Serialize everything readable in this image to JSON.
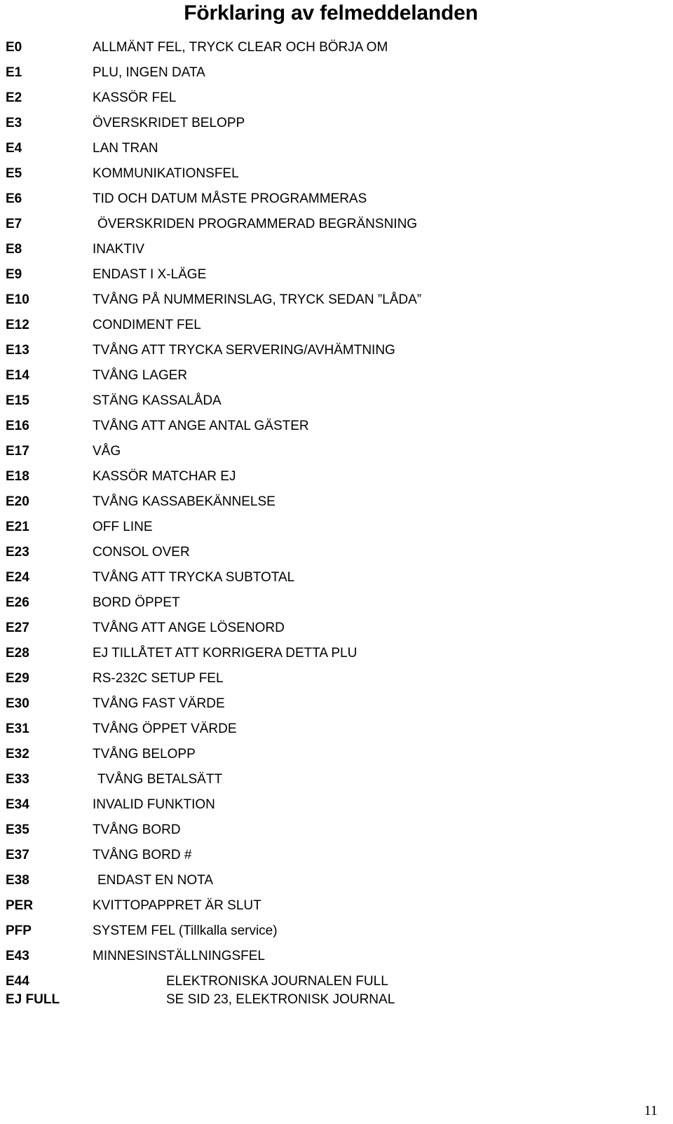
{
  "document": {
    "title": "Förklaring av felmeddelanden",
    "page_number": "11"
  },
  "error_table": {
    "rows": [
      {
        "code": "E0",
        "desc": "ALLMÄNT FEL, TRYCK CLEAR OCH BÖRJA OM"
      },
      {
        "code": "E1",
        "desc": "PLU, INGEN DATA"
      },
      {
        "code": "E2",
        "desc": "KASSÖR FEL"
      },
      {
        "code": "E3",
        "desc": "ÖVERSKRIDET BELOPP"
      },
      {
        "code": "E4",
        "desc": "LAN TRAN"
      },
      {
        "code": "E5",
        "desc": "KOMMUNIKATIONSFEL"
      },
      {
        "code": "E6",
        "desc": "TID OCH DATUM MÅSTE PROGRAMMERAS"
      },
      {
        "code": "E7",
        "desc": "ÖVERSKRIDEN PROGRAMMERAD BEGRÄNSNING"
      },
      {
        "code": "E8",
        "desc": "INAKTIV"
      },
      {
        "code": "E9",
        "desc": "ENDAST I X-LÄGE"
      },
      {
        "code": "E10",
        "desc": "TVÅNG PÅ NUMMERINSLAG, TRYCK SEDAN ”LÅDA”"
      },
      {
        "code": "E12",
        "desc": "CONDIMENT FEL"
      },
      {
        "code": "E13",
        "desc": "TVÅNG ATT TRYCKA SERVERING/AVHÄMTNING"
      },
      {
        "code": "E14",
        "desc": "TVÅNG LAGER"
      },
      {
        "code": "E15",
        "desc": "STÄNG KASSALÅDA"
      },
      {
        "code": "E16",
        "desc": "TVÅNG ATT ANGE ANTAL GÄSTER"
      },
      {
        "code": "E17",
        "desc": "VÅG"
      },
      {
        "code": "E18",
        "desc": "KASSÖR MATCHAR EJ"
      },
      {
        "code": "E20",
        "desc": "TVÅNG KASSABEKÄNNELSE"
      },
      {
        "code": "E21",
        "desc": "OFF LINE"
      },
      {
        "code": "E23",
        "desc": "CONSOL OVER"
      },
      {
        "code": "E24",
        "desc": "TVÅNG ATT TRYCKA SUBTOTAL"
      },
      {
        "code": "E26",
        "desc": "BORD ÖPPET"
      },
      {
        "code": "E27",
        "desc": "TVÅNG ATT ANGE LÖSENORD"
      },
      {
        "code": "E28",
        "desc": "EJ TILLÅTET ATT KORRIGERA DETTA PLU"
      },
      {
        "code": "E29",
        "desc": "RS-232C SETUP FEL"
      },
      {
        "code": "E30",
        "desc": "TVÅNG FAST VÄRDE"
      },
      {
        "code": "E31",
        "desc": "TVÅNG ÖPPET VÄRDE"
      },
      {
        "code": "E32",
        "desc": "TVÅNG BELOPP"
      },
      {
        "code": "E33",
        "desc": "TVÅNG BETALSÄTT"
      },
      {
        "code": "E34",
        "desc": "INVALID FUNKTION"
      },
      {
        "code": "E35",
        "desc": "TVÅNG BORD"
      },
      {
        "code": "E37",
        "desc": "TVÅNG BORD #"
      },
      {
        "code": "E38",
        "desc": "ENDAST EN NOTA"
      },
      {
        "code": "PER",
        "desc": "KVITTOPAPPRET ÄR SLUT"
      },
      {
        "code": "PFP",
        "desc": "SYSTEM FEL (Tillkalla service)"
      },
      {
        "code": "E43",
        "desc": "MINNESINSTÄLLNINGSFEL"
      },
      {
        "code": "E44",
        "desc": "ELEKTRONISKA JOURNALEN FULL"
      },
      {
        "code": "EJ FULL",
        "desc": "SE SID 23, ELEKTRONISK JOURNAL"
      }
    ]
  }
}
